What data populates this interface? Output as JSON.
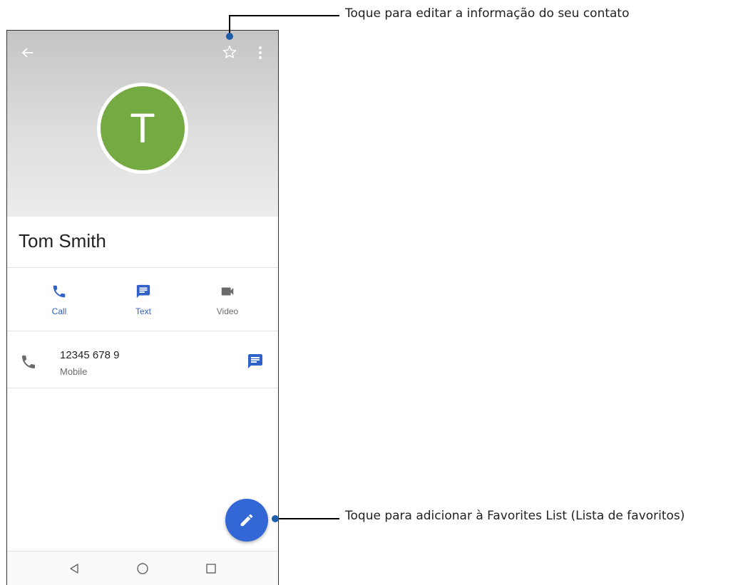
{
  "contact": {
    "initial": "T",
    "name": "Tom Smith",
    "avatar_color": "#75a942"
  },
  "header_icons": [
    "back-arrow-icon",
    "star-outline-icon",
    "more-vert-icon"
  ],
  "actions": [
    {
      "label": "Call",
      "icon": "phone-icon",
      "color": "#2f61c8"
    },
    {
      "label": "Text",
      "icon": "message-icon",
      "color": "#2f61c8"
    },
    {
      "label": "Video",
      "icon": "videocam-icon",
      "color": "#6b6b6b"
    }
  ],
  "phone_entry": {
    "number": "12345 678 9",
    "type": "Mobile"
  },
  "fab": {
    "icon": "pencil-edit-icon",
    "color": "#3367d6"
  },
  "navbar": [
    "back-triangle-icon",
    "home-circle-icon",
    "recents-square-icon"
  ],
  "callouts": {
    "top": "Toque para editar a informação do seu contato",
    "bottom": "Toque para adicionar à Favorites List (Lista de favoritos)"
  },
  "accent_color": "#1f5da8"
}
